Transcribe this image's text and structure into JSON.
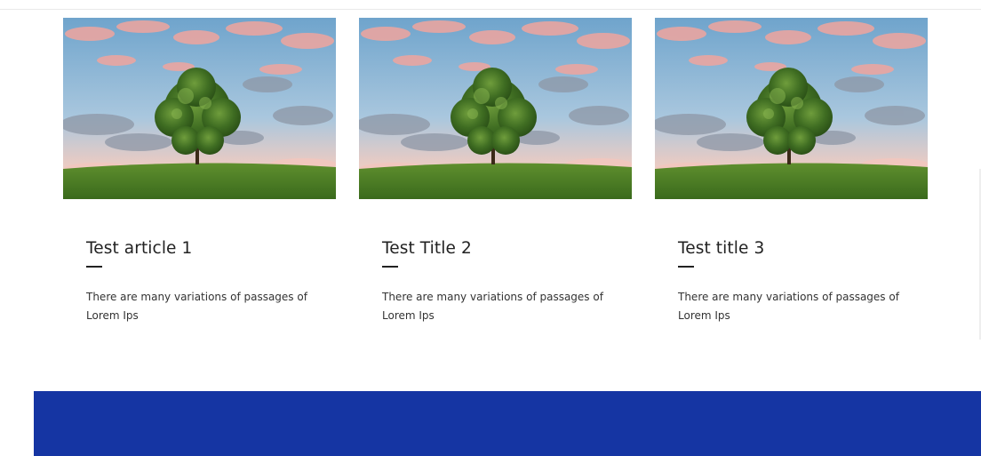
{
  "articles": [
    {
      "title": "Test article 1",
      "excerpt": "There are many variations of passages of Lorem Ips",
      "image": "tree-landscape-image"
    },
    {
      "title": "Test Title 2",
      "excerpt": "There are many variations of passages of Lorem Ips",
      "image": "tree-landscape-image"
    },
    {
      "title": "Test title 3",
      "excerpt": "There are many variations of passages of Lorem Ips",
      "image": "tree-landscape-image"
    }
  ],
  "colors": {
    "footer_band": "#1535a3",
    "title_text": "#222222",
    "body_text": "#333333"
  }
}
